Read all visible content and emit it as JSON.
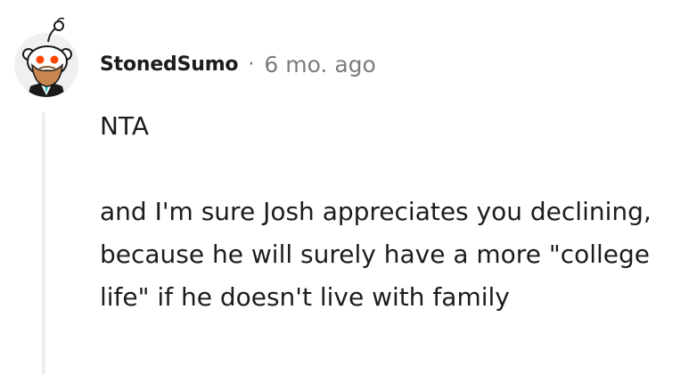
{
  "comment": {
    "username": "StonedSumo",
    "separator": "·",
    "timestamp": "6 mo. ago",
    "paragraphs": [
      "NTA",
      "and I'm sure Josh appreciates you declining, because he will surely have a more \"college life\" if he doesn't live with family"
    ]
  },
  "avatar": {
    "icon": "snoo-avatar-icon",
    "colors": {
      "background": "#eef0f1",
      "head": "#ffffff",
      "eyes": "#ff4500",
      "beard": "#c8874f",
      "shirt": "#1a1a1a",
      "tie": "#2bbdc6"
    }
  }
}
